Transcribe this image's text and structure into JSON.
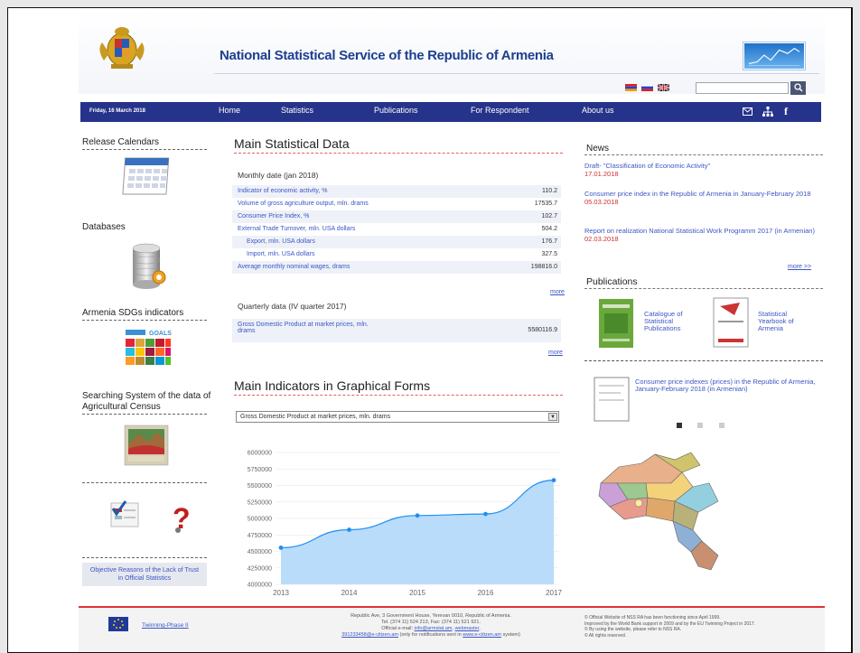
{
  "header": {
    "title": "National Statistical Service of the Republic of Armenia",
    "search_placeholder": ""
  },
  "nav": {
    "date": "Friday, 16 March 2018",
    "items": [
      "Home",
      "Statistics",
      "Publications",
      "For Respondent",
      "About us"
    ],
    "icons": [
      "mail-icon",
      "sitemap-icon",
      "facebook-icon"
    ]
  },
  "sidebar": {
    "release_calendars": "Release Calendars",
    "databases": "Databases",
    "sdg": "Armenia SDGs indicators",
    "census": "Searching System of the data of Agricultural Census",
    "objective": "Objective Reasons of the Lack of Trust in Official Statistics"
  },
  "main": {
    "title": "Main Statistical Data",
    "monthly_head": "Monthly date (jan 2018)",
    "monthly_rows": [
      {
        "label": "Indicator of economic activity, %",
        "value": "110.2"
      },
      {
        "label": "Volume of gross agriculture output, mln. drams",
        "value": "17535.7"
      },
      {
        "label": "Consumer Price Index, %",
        "value": "102.7"
      },
      {
        "label": "External Trade Turnover, mln. USA dollars",
        "value": "504.2"
      },
      {
        "label": "Export, mln. USA dollars",
        "value": "176.7"
      },
      {
        "label": "Import, mln. USA dollars",
        "value": "327.5"
      },
      {
        "label": "Average monthly nominal wages, drams",
        "value": "198816.0"
      }
    ],
    "more1": "more",
    "quarterly_head": "Quarterly data (IV quarter 2017)",
    "gdp_label_1": "Gross Domestic Product at market prices, mln.",
    "gdp_label_2": "drams",
    "gdp_value": "5580116.9",
    "more2": "more",
    "graph_title": "Main Indicators in Graphical Forms",
    "select_value": "Gross Domestic Product at market prices, mln. drams"
  },
  "chart_data": {
    "type": "area",
    "x": [
      "2013",
      "2014",
      "2015",
      "2016",
      "2017"
    ],
    "values": [
      4555638,
      4828626,
      5043633,
      5067294,
      5580117
    ],
    "yticks": [
      "6000000",
      "5750000",
      "5500000",
      "5250000",
      "5000000",
      "4750000",
      "4500000",
      "4250000",
      "4000000"
    ],
    "ylim": [
      4000000,
      6000000
    ],
    "color": "#1f8ff0",
    "fill": "#b9dcfb"
  },
  "news": {
    "title": "News",
    "items": [
      {
        "text": "Draft- \"Classification of Economic Activity\"",
        "date": "17.01.2018"
      },
      {
        "text": "Consumer price index in the Republic of Armenia in January-February 2018",
        "date": "05.03.2018"
      },
      {
        "text": "Report on realization National Statistical Work Programm 2017 (in Armenian)",
        "date": "02.03.2018"
      }
    ],
    "more": "more >>"
  },
  "publications": {
    "title": "Publications",
    "catalogue": "Catalogue of Statistical Publications",
    "yearbook": "Statistical Yearbook of Armenia",
    "cpi": "Consumer price indexes (prices) in the Republic of Armenia, January-February 2018 (in Armenian)"
  },
  "footer": {
    "twinning": "Twinning-Phase II",
    "address_1": "Republic Ave, 3 Government House, Yerevan 0010, Republic of Armenia.",
    "address_2": "Tel. (374 11) 524 213, Fax: (374 11) 521 921.",
    "email_prefix": "Official e-mail:",
    "email": "info@armstat.am",
    "webmaster": "webmaster",
    "esys_email": "391233458@e-citizen.am",
    "esys_mid": "(only for notifications sent in",
    "esys_link": "www.e-citizen.am",
    "esys_end": "system)",
    "notes": [
      "© Official Website of NSS RA has been functioning since April 1999.",
      "Improved by the World Bank support in 2009 and by the EU Twinning Project in 2017.",
      "© By using the website, please refer to NSS RA.",
      "© All rights reserved."
    ]
  }
}
